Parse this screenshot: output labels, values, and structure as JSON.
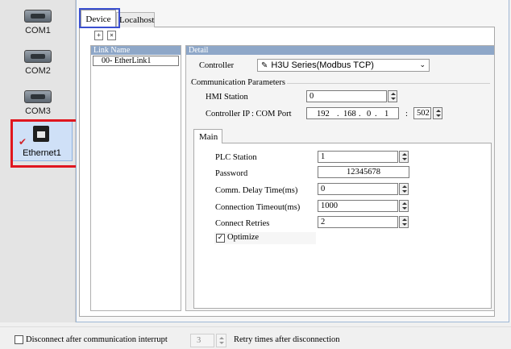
{
  "ports": [
    {
      "label": "COM1",
      "icon": "serial-port-icon"
    },
    {
      "label": "COM2",
      "icon": "serial-port-icon"
    },
    {
      "label": "COM3",
      "icon": "serial-port-icon"
    },
    {
      "label": "Ethernet1",
      "icon": "ethernet-port-icon",
      "selected": true,
      "status_icon": "checkmark-icon"
    }
  ],
  "tabs": {
    "device": "Device",
    "localhost": "Localhost"
  },
  "toolbar": {
    "add": "+",
    "remove": "×"
  },
  "link_list": {
    "header": "Link Name",
    "items": [
      "00- EtherLink1"
    ]
  },
  "detail": {
    "header": "Detail",
    "controller_label": "Controller",
    "controller_value": "H3U Series(Modbus TCP)",
    "comm_params_title": "Communication Parameters",
    "hmi_station_label": "HMI Station",
    "hmi_station_value": "0",
    "controller_ip_label": "Controller IP",
    "com_port_label": ": COM Port",
    "ip": [
      "192",
      "168",
      "0",
      "1"
    ],
    "ip_sep": ".",
    "port_sep": ":",
    "com_port_value": "502"
  },
  "main": {
    "tab_label": "Main",
    "plc_station_label": "PLC Station",
    "plc_station_value": "1",
    "password_label": "Password",
    "password_value": "12345678",
    "comm_delay_label": "Comm. Delay Time(ms)",
    "comm_delay_value": "0",
    "conn_timeout_label": "Connection Timeout(ms)",
    "conn_timeout_value": "1000",
    "connect_retries_label": "Connect Retries",
    "connect_retries_value": "2",
    "optimize_label": "Optimize",
    "optimize_checked": "✓"
  },
  "bottom": {
    "disconnect_label": "Disconnect after communication interrupt",
    "retry_count": "3",
    "retry_label": "Retry times after disconnection"
  },
  "colors": {
    "accent_highlight": "#e0161f",
    "tab_highlight": "#3a4fd0",
    "header_blue": "#8ea7c8"
  }
}
